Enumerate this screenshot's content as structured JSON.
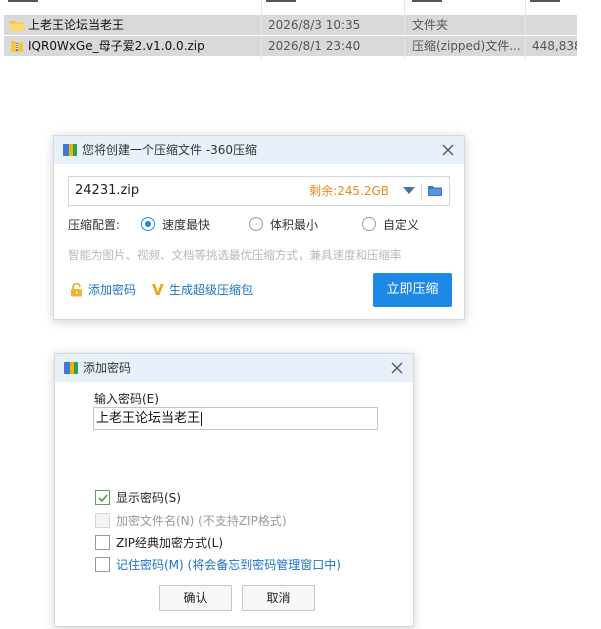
{
  "filelist": {
    "rows": [
      {
        "name": "上老王论坛当老王",
        "date": "2026/8/3 10:35",
        "type": "文件夹",
        "size": "",
        "icon": "folder-icon"
      },
      {
        "name": "IQR0WxGe_母子爱2.v1.0.0.zip",
        "date": "2026/8/1 23:40",
        "type": "压缩(zipped)文件...",
        "size": "448,838",
        "icon": "zip-file-icon"
      }
    ]
  },
  "compress_dialog": {
    "title": "您将创建一个压缩文件 -360压缩",
    "filename": "24231.zip",
    "remaining": "剩余:245.2GB",
    "config_label": "压缩配置:",
    "options": [
      {
        "label": "速度最快",
        "selected": true
      },
      {
        "label": "体积最小",
        "selected": false
      },
      {
        "label": "自定义",
        "selected": false
      }
    ],
    "hint": "智能为图片、视频、文档等挑选最优压缩方式，兼具速度和压缩率",
    "add_password_link": "添加密码",
    "super_package_link": "生成超级压缩包",
    "compress_button": "立即压缩",
    "colors": {
      "accent": "#1e88e5",
      "remaining": "#e88a1a",
      "title_bar": "#e8f1fb"
    }
  },
  "password_dialog": {
    "title": "添加密码",
    "input_label": "输入密码(E)",
    "password_value": "上老王论坛当老王",
    "checkboxes": [
      {
        "label": "显示密码(S)",
        "checked": true,
        "disabled": false
      },
      {
        "label": "加密文件名(N) (不支持ZIP格式)",
        "checked": false,
        "disabled": true
      },
      {
        "label": "ZIP经典加密方式(L)",
        "checked": false,
        "disabled": false
      },
      {
        "label": "记住密码(M) (将会备忘到密码管理窗口中)",
        "checked": false,
        "disabled": false
      }
    ],
    "ok_button": "确认",
    "cancel_button": "取消"
  }
}
